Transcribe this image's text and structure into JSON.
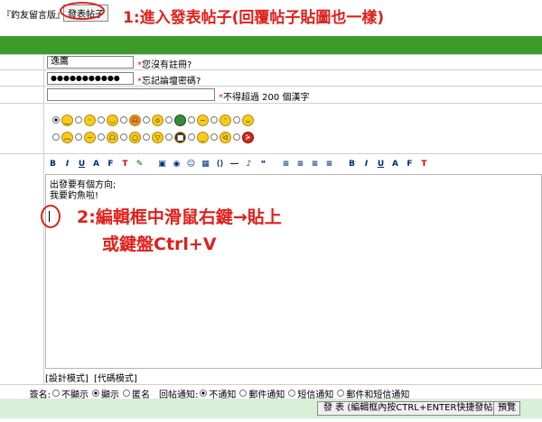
{
  "breadcrumb": "『釣友留言版』",
  "post_button": "發表帖子",
  "annotation_1": "1:進入發表帖子(回覆帖子貼圖也一樣)",
  "form": {
    "username_value": "逸鷹",
    "username_hint_star": "*",
    "username_hint": "您沒有註冊?",
    "password_value": "●●●●●●●●●●●",
    "password_hint_star": "*",
    "password_hint": "忘記論壇密碼?",
    "title_value": "",
    "title_hint_star": "*",
    "title_hint": "不得超過 200 個漢字"
  },
  "smileys": {
    "row1": [
      "smile",
      "tongue",
      "grin",
      "angry",
      "surprise",
      "turtle",
      "worried",
      "wink",
      "blush"
    ],
    "row2": [
      "sad",
      "confused",
      "cry",
      "shock",
      "laugh",
      "cool",
      "frown",
      "evil",
      "mad"
    ],
    "selected_index": 0
  },
  "toolbar_icons": [
    "bold",
    "italic",
    "underline",
    "font",
    "font-size",
    "font-color",
    "highlight",
    "sep",
    "image",
    "swf",
    "emoticon",
    "table",
    "code",
    "hr",
    "sep",
    "wma",
    "align-left",
    "align-center",
    "align-right",
    "sep",
    "bold2",
    "italic2",
    "underline2",
    "font2",
    "font-size2",
    "font-color2"
  ],
  "editor": {
    "line1": "出發要有個方向;",
    "line2": "我要釣魚啦!"
  },
  "annotation_2_line1": "2:編輯框中滑鼠右鍵→貼上",
  "annotation_2_line2": "或鍵盤Ctrl+V",
  "mode_tabs": [
    "[設計模式]",
    "[代碼模式]"
  ],
  "options": {
    "sign_label": "簽名:",
    "sign_options": [
      "不顯示",
      "顯示",
      "匿名"
    ],
    "notify_label": "回帖通知:",
    "notify_options": [
      "不通知",
      "郵件通知",
      "短信通知",
      "郵件和短信通知"
    ]
  },
  "submit_label": "發 表 (編輯框內按CTRL+ENTER快捷發帖)",
  "preview_label": "預覽",
  "colors": {
    "green_bar": "#3f9a2c",
    "annotation": "#e0201a",
    "bottom_bar": "#d8efd8"
  }
}
